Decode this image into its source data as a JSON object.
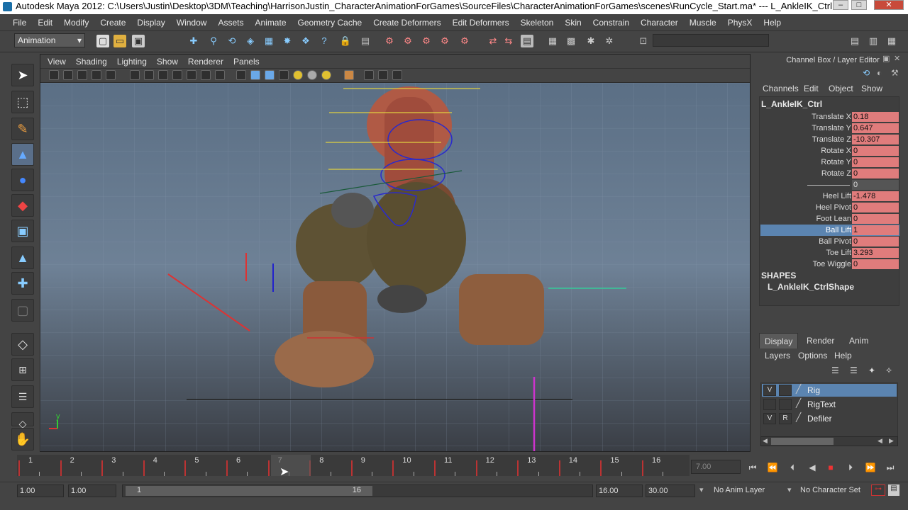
{
  "window": {
    "title": "Autodesk Maya 2012: C:\\Users\\Justin\\Desktop\\3DM\\Teaching\\HarrisonJustin_CharacterAnimationForGames\\SourceFiles\\CharacterAnimationForGames\\scenes\\RunCycle_Start.ma*   ---   L_AnkleIK_Ctrl",
    "minimize": "–",
    "maximize": "□",
    "close": "✕"
  },
  "menu": [
    "File",
    "Edit",
    "Modify",
    "Create",
    "Display",
    "Window",
    "Assets",
    "Animate",
    "Geometry Cache",
    "Create Deformers",
    "Edit Deformers",
    "Skeleton",
    "Skin",
    "Constrain",
    "Character",
    "Muscle",
    "PhysX",
    "Help"
  ],
  "statusline": {
    "mode": "Animation"
  },
  "viewport": {
    "menu": [
      "View",
      "Shading",
      "Lighting",
      "Show",
      "Renderer",
      "Panels"
    ],
    "axis_y": "y"
  },
  "channelbox": {
    "title": "Channel Box / Layer Editor",
    "menu": [
      "Channels",
      "Edit",
      "Object",
      "Show"
    ],
    "object": "L_AnkleIK_Ctrl",
    "attributes": [
      {
        "label": "Translate X",
        "value": "0.18"
      },
      {
        "label": "Translate Y",
        "value": "0.647"
      },
      {
        "label": "Translate Z",
        "value": "-10.307"
      },
      {
        "label": "Rotate X",
        "value": "0"
      },
      {
        "label": "Rotate Y",
        "value": "0"
      },
      {
        "label": "Rotate Z",
        "value": "0"
      },
      {
        "label": "",
        "value": "0"
      },
      {
        "label": "Heel Lift",
        "value": "-1.478"
      },
      {
        "label": "Heel Pivot",
        "value": "0"
      },
      {
        "label": "Foot Lean",
        "value": "0"
      },
      {
        "label": "Ball Lift",
        "value": "1"
      },
      {
        "label": "Ball Pivot",
        "value": "0"
      },
      {
        "label": "Toe Lift",
        "value": "3.293"
      },
      {
        "label": "Toe Wiggle",
        "value": "0"
      }
    ],
    "shapes_header": "SHAPES",
    "shape_name": "L_AnkleIK_CtrlShape"
  },
  "layers": {
    "tabs": [
      "Display",
      "Render",
      "Anim"
    ],
    "menu": [
      "Layers",
      "Options",
      "Help"
    ],
    "items": [
      {
        "v": "V",
        "r": "",
        "name": "Rig"
      },
      {
        "v": "",
        "r": "",
        "name": "RigText"
      },
      {
        "v": "V",
        "r": "R",
        "name": "Defiler"
      }
    ]
  },
  "timeline": {
    "frames": [
      "1",
      "2",
      "3",
      "4",
      "5",
      "6",
      "7",
      "8",
      "9",
      "10",
      "11",
      "12",
      "13",
      "14",
      "15",
      "16"
    ],
    "current_frame": "7.00"
  },
  "range": {
    "start": "1.00",
    "start2": "1.00",
    "slider_start": "1",
    "slider_end": "16",
    "end": "16.00",
    "end2": "30.00",
    "anim_layer": "No Anim Layer",
    "character_set": "No Character Set"
  }
}
